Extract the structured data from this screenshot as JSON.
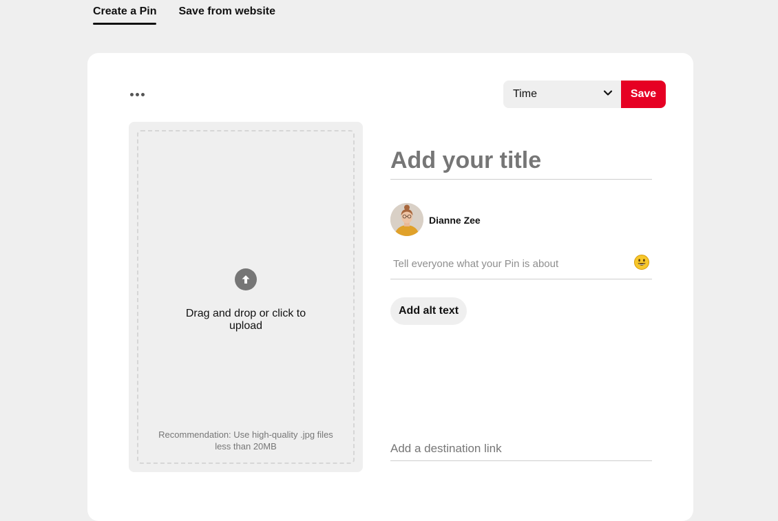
{
  "tabs": [
    {
      "label": "Create a Pin",
      "active": true
    },
    {
      "label": "Save from website",
      "active": false
    }
  ],
  "toolbar": {
    "more_icon": "more-dots-icon",
    "board_select_value": "Time",
    "save_label": "Save"
  },
  "upload": {
    "icon": "upload-arrow-icon",
    "text": "Drag and drop or click to upload",
    "recommendation": "Recommendation: Use high-quality .jpg files less than 20MB"
  },
  "form": {
    "title_placeholder": "Add your title",
    "user_name": "Dianne Zee",
    "description_placeholder": "Tell everyone what your Pin is about",
    "emoji_icon": "smiley-emoji-icon",
    "alt_text_label": "Add alt text",
    "link_placeholder": "Add a destination link"
  },
  "colors": {
    "accent": "#e60023",
    "background": "#efefef"
  }
}
